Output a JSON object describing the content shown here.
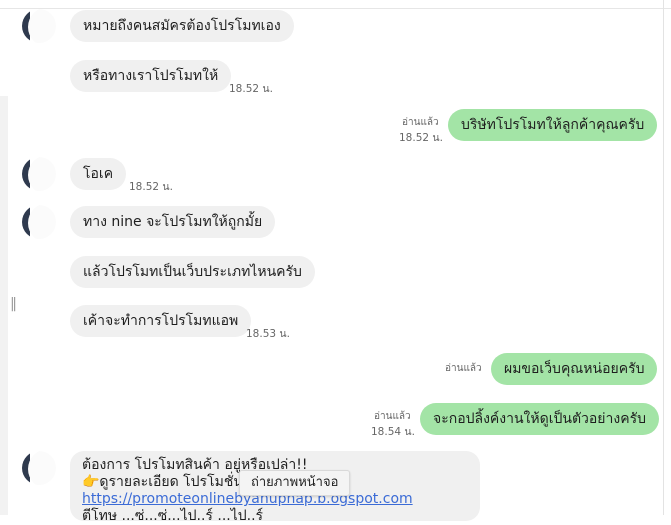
{
  "messages": [
    {
      "text": "หมายถึงคนสมัครต้องโปรโมทเอง"
    },
    {
      "text": "หรือทางเราโปรโมทให้",
      "time": "18.52 น."
    },
    {
      "text": "บริษัทโปรโมทให้ลูกค้าคุณครับ",
      "read": "อ่านแล้ว",
      "time": "18.52 น."
    },
    {
      "text": "โอเค",
      "time": "18.52 น."
    },
    {
      "text": "ทาง nine จะโปรโมทให้ถูกมั้ย"
    },
    {
      "text": "แล้วโปรโมทเป็นเว็บประเภทไหนครับ"
    },
    {
      "text": "เค้าจะทำการโปรโมทแอพ",
      "time": "18.53 น."
    },
    {
      "text": "ผมขอเว็บคุณหน่อยครับ",
      "read": "อ่านแล้ว"
    },
    {
      "text": "จะกอปลิ้งค์งานให้ดูเป็นตัวอย่างครับ",
      "read": "อ่านแล้ว",
      "time": "18.54 น."
    }
  ],
  "card": {
    "line1": "ต้องการ โปรโมทสินค้า อยู่หรือเปล่า!!",
    "line2": "👉ดูรายละเอียด โปรโมชั่นต",
    "link": "https://promoteonlinebyanuphap.b.ogspot.com",
    "line4": "ตีโทษ ...ซ่...ซ่...ไป..ร์ ...ไป..ร์"
  },
  "tooltip": "ถ่ายภาพหน้าจอ",
  "colors": {
    "incoming": "#f0f0f0",
    "outgoing": "#a3e4a6",
    "link": "#3b6bd6"
  }
}
